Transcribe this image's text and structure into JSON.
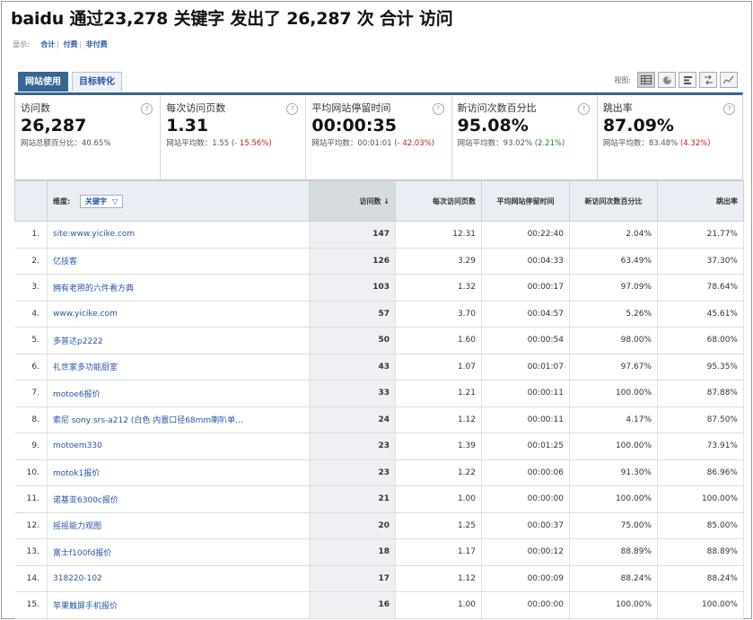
{
  "title": "baidu 通过23,278 关键字 发出了 26,287 次 合计 访问",
  "show": {
    "label": "显示:",
    "options": [
      "合计",
      "付费",
      "非付费"
    ]
  },
  "tabs": [
    "网站使用",
    "目标转化"
  ],
  "view": {
    "label": "视图:",
    "buttons": [
      "table-icon",
      "pie-icon",
      "compare-icon",
      "pivot-icon",
      "trend-icon"
    ]
  },
  "metrics": [
    {
      "label": "访问数",
      "value": "26,287",
      "sub": "网站总额百分比：40.65%",
      "delta": "",
      "help": "?"
    },
    {
      "label": "每次访问页数",
      "value": "1.31",
      "sub": "网站平均数：1.55 (-",
      "delta": "15.56%)",
      "help": "?"
    },
    {
      "label": "平均网站停留时间",
      "value": "00:00:35",
      "sub": "网站平均数：00:01:01 (-",
      "delta": "42.03%)",
      "help": "?"
    },
    {
      "label": "新访问次数百分比",
      "value": "95.08%",
      "sub": "网站平均数：93.02%",
      "delta": "(2.21%)",
      "help": "?"
    },
    {
      "label": "跳出率",
      "value": "87.09%",
      "sub": "网站平均数：83.48%",
      "delta": "(4.32%)",
      "help": "?"
    }
  ],
  "table": {
    "dimension_label": "维度:",
    "dimension_value": "关键字",
    "dimension_caret": "▽",
    "headers": [
      "访问数 ↓",
      "每次访问页数",
      "平均网站停留时间",
      "新访问次数百分比",
      "跳出率"
    ],
    "rows": [
      [
        "1.",
        "site:www.yicike.com",
        "147",
        "12.31",
        "00:22:40",
        "2.04%",
        "21.77%"
      ],
      [
        "2.",
        "亿技客",
        "126",
        "3.29",
        "00:04:33",
        "63.49%",
        "37.30%"
      ],
      [
        "3.",
        "拥有老照的六件看方典",
        "103",
        "1.32",
        "00:00:17",
        "97.09%",
        "78.64%"
      ],
      [
        "4.",
        "www.yicike.com",
        "57",
        "3.70",
        "00:04:57",
        "5.26%",
        "45.61%"
      ],
      [
        "5.",
        "多普达p2222",
        "50",
        "1.60",
        "00:00:54",
        "98.00%",
        "68.00%"
      ],
      [
        "6.",
        "礼世家多功能厨室",
        "43",
        "1.07",
        "00:01:07",
        "97.67%",
        "95.35%"
      ],
      [
        "7.",
        "motoe6报价",
        "33",
        "1.21",
        "00:00:11",
        "100.00%",
        "87.88%"
      ],
      [
        "8.",
        "索尼 sony srs-a212 (白色 内置口径68mm喇叭单...",
        "24",
        "1.12",
        "00:00:11",
        "4.17%",
        "87.50%"
      ],
      [
        "9.",
        "motoem330",
        "23",
        "1.39",
        "00:01:25",
        "100.00%",
        "73.91%"
      ],
      [
        "10.",
        "motok1报价",
        "23",
        "1.22",
        "00:00:06",
        "91.30%",
        "86.96%"
      ],
      [
        "11.",
        "诺基亚6300c报价",
        "21",
        "1.00",
        "00:00:00",
        "100.00%",
        "100.00%"
      ],
      [
        "12.",
        "摇摇能力观图",
        "20",
        "1.25",
        "00:00:37",
        "75.00%",
        "85.00%"
      ],
      [
        "13.",
        "富士f100fd报价",
        "18",
        "1.17",
        "00:00:12",
        "88.89%",
        "88.89%"
      ],
      [
        "14.",
        "318220-102",
        "17",
        "1.12",
        "00:00:09",
        "88.24%",
        "88.24%"
      ],
      [
        "15.",
        "苹果触屏手机报价",
        "16",
        "1.00",
        "00:00:00",
        "100.00%",
        "100.00%"
      ]
    ]
  }
}
